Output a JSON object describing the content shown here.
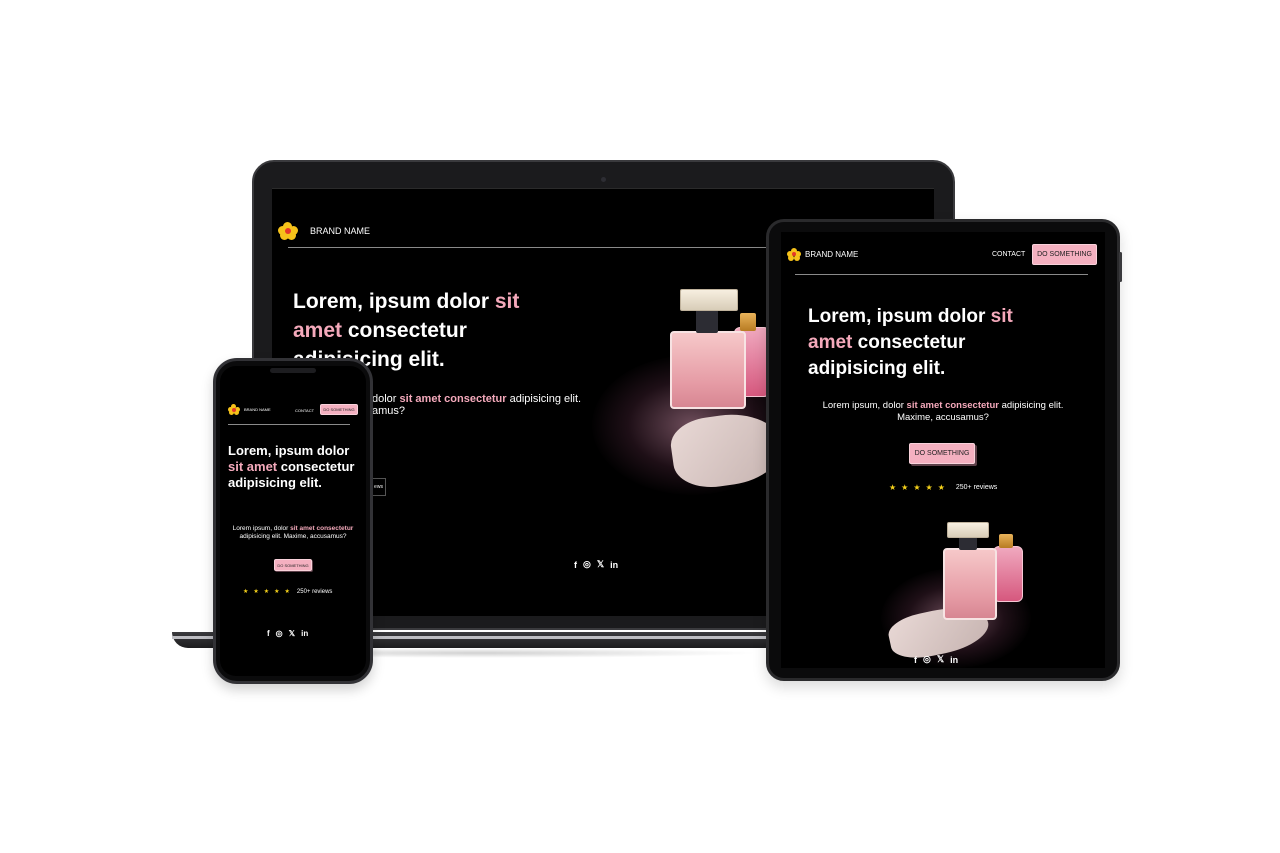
{
  "brand": {
    "name": "BRAND NAME",
    "logo_icon": "flower-icon"
  },
  "nav": {
    "contact": "CONTACT",
    "cta": "DO SOMETHING"
  },
  "hero": {
    "headline_part1": "Lorem, ipsum dolor",
    "headline_highlight": "sit amet",
    "headline_part2": "consectetur adipisicing elit.",
    "paragraph_part1": "Lorem ipsum, dolor",
    "paragraph_highlight": "sit amet consectetur",
    "paragraph_part2": "adipisicing elit. Maxime, accusamus?",
    "cta": "DO SOMETHING",
    "rating_stars": 5,
    "reviews": "250+ reviews"
  },
  "laptop_partial": {
    "paragraph_visible_start": "dolor",
    "paragraph_visible_highlight": "sit amet consectetur",
    "paragraph_visible_end": "adipisicing elit.",
    "paragraph_visible_line2": "amus?",
    "reviews_fragment": "ews"
  },
  "social": {
    "facebook": "f",
    "instagram": "◎",
    "x": "𝕏",
    "linkedin": "in"
  },
  "colors": {
    "background": "#000000",
    "highlight": "#f4a9bb",
    "cta": "#f4b0c0",
    "star": "#f6d21a"
  }
}
